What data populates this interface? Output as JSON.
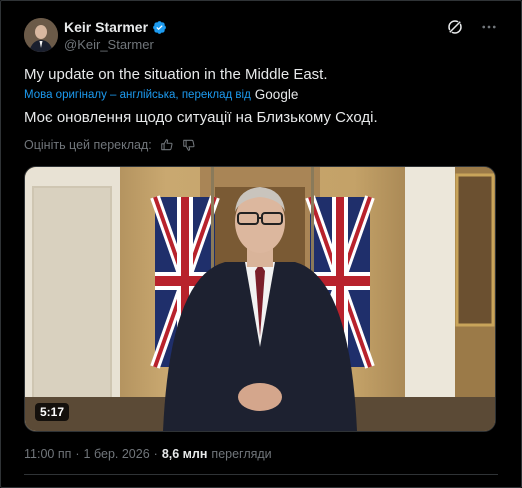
{
  "author": {
    "name": "Keir Starmer",
    "handle": "@Keir_Starmer",
    "verified": true
  },
  "post": {
    "text": "My update on the situation in the Middle East.",
    "translation_note": "Мова оригіналу – англійська, переклад від",
    "translation_provider": "Google",
    "translated_text": "Моє оновлення щодо ситуації на Близькому Сході.",
    "rate_prompt": "Оцініть цей переклад:"
  },
  "video": {
    "duration": "5:17"
  },
  "meta": {
    "time": "11:00 пп",
    "separator": "·",
    "date": "1 бер. 2026",
    "views_count": "8,6 млн",
    "views_label": "перегляди"
  },
  "colors": {
    "background": "#000000",
    "text": "#e7e9ea",
    "muted": "#71767b",
    "link": "#1d9bf0",
    "verified": "#1d9bf0"
  }
}
